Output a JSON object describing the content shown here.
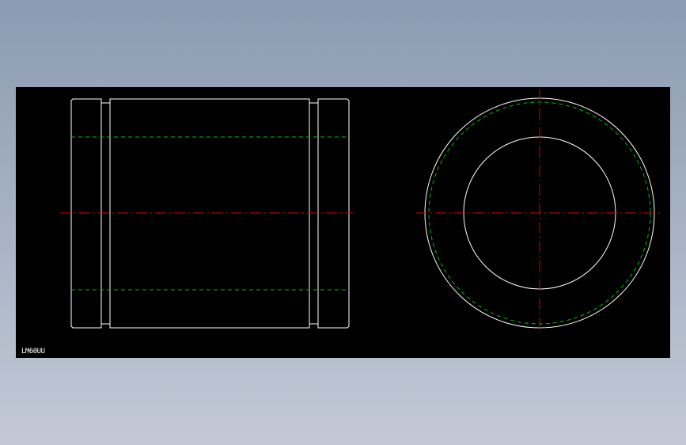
{
  "drawing": {
    "part_label": "LM60UU",
    "colors": {
      "background": "#000000",
      "outline": "#ffffff",
      "hidden_line": "#00c000",
      "center_line": "#e00000",
      "window_background_top": "#8b9bb1",
      "window_background_bottom": "#c3c9d6"
    },
    "views": [
      "side-view",
      "end-view"
    ]
  }
}
